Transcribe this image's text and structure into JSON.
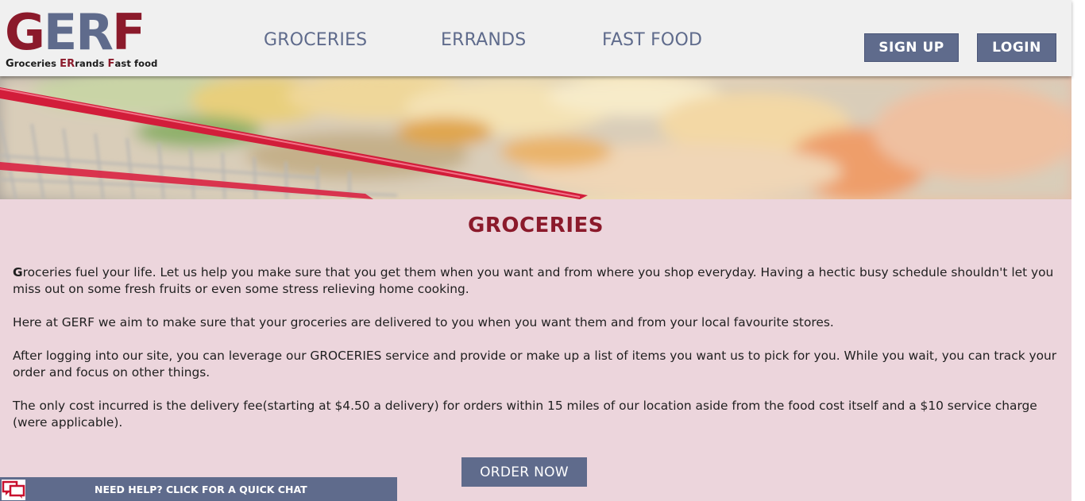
{
  "logo": {
    "letters": [
      "G",
      "E",
      "R",
      "F"
    ],
    "tagline_parts": [
      "G",
      "roceries ",
      "ER",
      "rands ",
      "F",
      "ast food"
    ]
  },
  "nav": {
    "items": [
      "GROCERIES",
      "ERRANDS",
      "FAST FOOD"
    ],
    "sign_up": "SIGN UP",
    "login": "LOGIN"
  },
  "section": {
    "title": "GROCERIES",
    "p1_dropcap": "G",
    "p1_rest": "roceries fuel your life. Let us help you make sure that you get them when you want and from where you shop everyday. Having a hectic busy schedule shouldn't let you miss out on some fresh fruits or even some stress relieving home cooking.",
    "p2": "Here at GERF we aim to make sure that your groceries are delivered to you when you want them and from your local favourite stores.",
    "p3": "After logging into our site, you can leverage our GROCERIES service and provide or make up a list of items you want us to pick for you. While you wait, you can track your order and focus on other things.",
    "p4": "The only cost incurred is the delivery fee(starting at $4.50 a delivery) for orders within 15 miles of our location aside from the food cost itself and a $10 service charge (were applicable).",
    "order_button": "ORDER NOW"
  },
  "chat": {
    "label": "NEED HELP? CLICK FOR A QUICK CHAT",
    "icon": "chat-bubbles-icon"
  },
  "colors": {
    "brand_red": "#8b1a2b",
    "brand_slate": "#5f6b8c",
    "content_bg": "#ecd5dc",
    "header_bg": "#f0f0f0"
  }
}
